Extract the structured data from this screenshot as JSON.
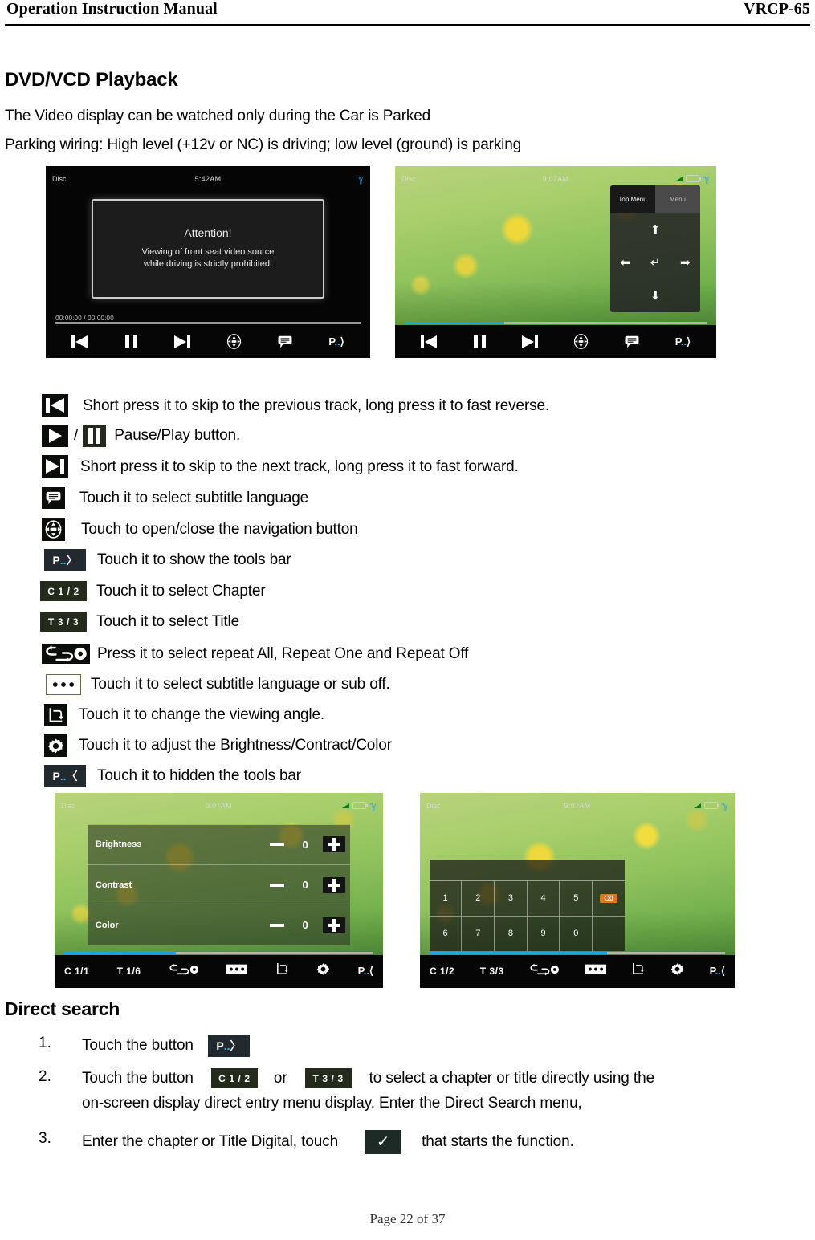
{
  "header": {
    "left_title": "Operation Instruction Manual",
    "right_model": "VRCP-65"
  },
  "sections": {
    "dvd_playback_title": "DVD/VCD Playback",
    "video_notice": "The Video display can be watched only during the Car is Parked",
    "parking_wiring": "Parking wiring: High level (+12v or NC) is driving; low level (ground) is parking",
    "direct_search_title": "Direct search"
  },
  "screenshots": {
    "attention": {
      "source": "Disc",
      "time": "5:42AM",
      "dialog_title": "Attention!",
      "dialog_line1": "Viewing of front seat video source",
      "dialog_line2": "while driving is strictly prohibited!",
      "timecode": "00:00:00  /  00:00:00",
      "progress_percent": 0
    },
    "navigation": {
      "source": "Disc",
      "time": "9:07AM",
      "tab_top_menu": "Top Menu",
      "tab_menu": "Menu",
      "arrow_up": "⬆",
      "arrow_left": "⬅",
      "arrow_right": "➡",
      "arrow_down": "⬇",
      "arrow_enter": "↵",
      "progress_percent": 33
    },
    "brightness": {
      "source": "Disc",
      "time": "9:07AM",
      "rows": [
        {
          "label": "Brightness",
          "value": "0"
        },
        {
          "label": "Contrast",
          "value": "0"
        },
        {
          "label": "Color",
          "value": "0"
        }
      ],
      "chapter_tag": "C 1/1",
      "title_tag": "T 1/6",
      "progress_percent": 36
    },
    "keypad": {
      "source": "Disc",
      "time": "9:07AM",
      "row1": [
        "1",
        "2",
        "3",
        "4",
        "5"
      ],
      "row2": [
        "6",
        "7",
        "8",
        "9",
        "0"
      ],
      "delete_label": "⌫",
      "chapter_tag": "C 1/2",
      "title_tag": "T 3/3",
      "progress_percent": 60
    }
  },
  "legend": [
    {
      "icon": "previous-track-icon",
      "text": "Short press it to skip to the previous track, long press it to fast reverse."
    },
    {
      "icon": "play-pause-icon",
      "text": "Pause/Play button.",
      "separator": "/"
    },
    {
      "icon": "next-track-icon",
      "text": "Short press it to skip to the next track, long press it to fast forward."
    },
    {
      "icon": "subtitle-icon",
      "text": "Touch it to select subtitle language"
    },
    {
      "icon": "navigation-pad-icon",
      "text": "Touch to open/close the navigation button"
    },
    {
      "icon": "show-toolbar-icon",
      "text": "Touch it to show the tools bar",
      "label": "P",
      "dots": "..",
      "chev": "〉"
    },
    {
      "icon": "chapter-tag-icon",
      "text": "Touch it to select Chapter",
      "label": "C 1 / 2"
    },
    {
      "icon": "title-tag-icon",
      "text": "Touch it to select Title",
      "label": "T 3 / 3"
    },
    {
      "icon": "repeat-icon",
      "text": "Press it to select repeat All, Repeat One and Repeat Off"
    },
    {
      "icon": "subtitle-dots-icon",
      "text": "Touch it to select subtitle language or sub off."
    },
    {
      "icon": "viewing-angle-icon",
      "text": "Touch it to change the viewing angle."
    },
    {
      "icon": "gear-icon",
      "text": "Touch it to adjust the Brightness/Contract/Color"
    },
    {
      "icon": "hide-toolbar-icon",
      "text": "Touch it to hidden the tools bar",
      "label": "P",
      "dots": "..",
      "chev": "〈"
    }
  ],
  "direct_search_steps": {
    "step1_index": "1.",
    "step1_text": "Touch the button",
    "step1_button": {
      "label": "P",
      "dots": "..",
      "chev": "〉"
    },
    "step2_index": "2.",
    "step2_text_a": "Touch   the   button",
    "step2_button_a": "C 1 / 2",
    "step2_or": "or",
    "step2_button_b": "T 3 / 3",
    "step2_text_b": "to   select   a   chapter   or   title   directly   using   the",
    "step2_text_c": "on-screen display direct entry menu display. Enter the Direct Search menu,",
    "step3_index": "3.",
    "step3_text_a": "Enter the chapter or Title Digital, touch",
    "step3_button": "✓",
    "step3_text_b": "that starts the function."
  },
  "footer": {
    "page_label": "Page 22 of 37"
  },
  "colors": {
    "accent_blue": "#3fb7e6",
    "progress_blue": "#1aa6e8",
    "delete_orange": "#e07820",
    "chip_dark": "#0b0d0a",
    "chip_olive": "#252b1c"
  }
}
